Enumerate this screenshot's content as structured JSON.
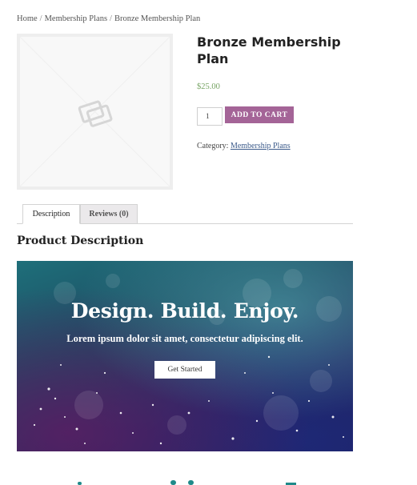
{
  "breadcrumb": {
    "items": [
      "Home",
      "Membership Plans",
      "Bronze Membership Plan"
    ],
    "separator": "/"
  },
  "product": {
    "title": "Bronze Membership Plan",
    "price": "$25.00",
    "quantity": "1",
    "add_to_cart_label": "ADD TO CART",
    "category_label": "Category:",
    "category_link": "Membership Plans"
  },
  "tabs": [
    {
      "label": "Description",
      "active": true
    },
    {
      "label": "Reviews (0)",
      "active": false
    }
  ],
  "description": {
    "heading": "Product Description"
  },
  "banner": {
    "title": "Design. Build. Enjoy.",
    "subtitle": "Lorem ipsum dolor sit amet, consectetur adipiscing elit.",
    "button_label": "Get Started"
  },
  "colors": {
    "accent": "#a46497",
    "price": "#77a464",
    "link": "#3b5a8a",
    "bottom_icons": "#1f8a8a"
  },
  "icons": [
    "placeholder-image-icon"
  ]
}
